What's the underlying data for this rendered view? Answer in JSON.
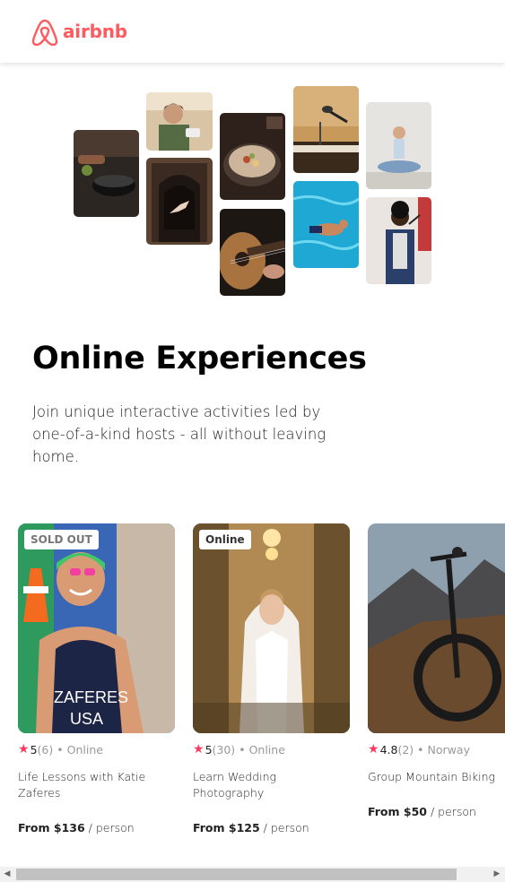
{
  "header": {
    "brand": "airbnb",
    "brand_color": "#FF5A5F"
  },
  "hero": {
    "title": "Online Experiences",
    "description": "Join unique interactive activities led by one-of-a-kind hosts - all without leaving home."
  },
  "photo_grid": [
    {
      "subject": "cooking-pot"
    },
    {
      "subject": "woman-with-camera"
    },
    {
      "subject": "dancer-in-doorway"
    },
    {
      "subject": "food-bowl"
    },
    {
      "subject": "acoustic-guitar"
    },
    {
      "subject": "microphone-keyboard"
    },
    {
      "subject": "swimmer"
    },
    {
      "subject": "yoga"
    },
    {
      "subject": "singer"
    }
  ],
  "cards": [
    {
      "badge": "SOLD OUT",
      "rating": "5",
      "count": "(6)",
      "location": "Online",
      "title": "Life Lessons with Katie Zaferes",
      "price_from": "From $136",
      "price_per": "/ person"
    },
    {
      "badge": "Online",
      "rating": "5",
      "count": "(30)",
      "location": "Online",
      "title": "Learn Wedding Photography",
      "price_from": "From $125",
      "price_per": "/ person"
    },
    {
      "badge": "",
      "rating": "4.8",
      "count": "(2)",
      "location": "Norway",
      "title": "Group Mountain Biking",
      "price_from": "From $50",
      "price_per": "/ person"
    }
  ],
  "separator": "•",
  "star_glyph": "★",
  "scrollbar": {
    "left_arrow": "◀",
    "right_arrow": "▶"
  },
  "colors": {
    "star": "#FE395C",
    "text": "#222222",
    "muted": "#999999"
  }
}
